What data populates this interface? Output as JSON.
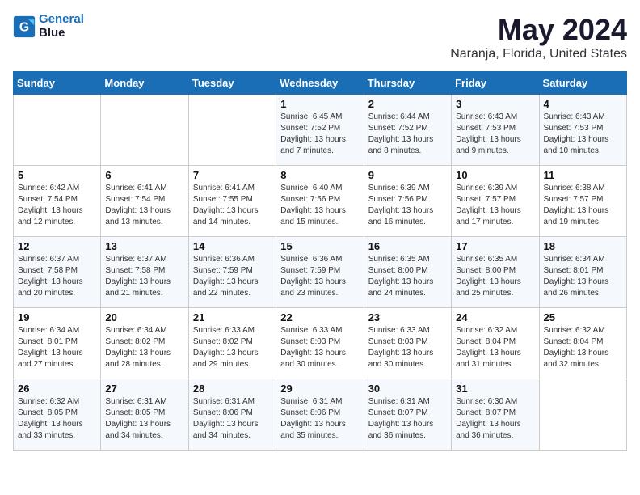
{
  "header": {
    "logo_line1": "General",
    "logo_line2": "Blue",
    "title": "May 2024",
    "subtitle": "Naranja, Florida, United States"
  },
  "weekdays": [
    "Sunday",
    "Monday",
    "Tuesday",
    "Wednesday",
    "Thursday",
    "Friday",
    "Saturday"
  ],
  "weeks": [
    [
      {
        "day": "",
        "info": ""
      },
      {
        "day": "",
        "info": ""
      },
      {
        "day": "",
        "info": ""
      },
      {
        "day": "1",
        "info": "Sunrise: 6:45 AM\nSunset: 7:52 PM\nDaylight: 13 hours\nand 7 minutes."
      },
      {
        "day": "2",
        "info": "Sunrise: 6:44 AM\nSunset: 7:52 PM\nDaylight: 13 hours\nand 8 minutes."
      },
      {
        "day": "3",
        "info": "Sunrise: 6:43 AM\nSunset: 7:53 PM\nDaylight: 13 hours\nand 9 minutes."
      },
      {
        "day": "4",
        "info": "Sunrise: 6:43 AM\nSunset: 7:53 PM\nDaylight: 13 hours\nand 10 minutes."
      }
    ],
    [
      {
        "day": "5",
        "info": "Sunrise: 6:42 AM\nSunset: 7:54 PM\nDaylight: 13 hours\nand 12 minutes."
      },
      {
        "day": "6",
        "info": "Sunrise: 6:41 AM\nSunset: 7:54 PM\nDaylight: 13 hours\nand 13 minutes."
      },
      {
        "day": "7",
        "info": "Sunrise: 6:41 AM\nSunset: 7:55 PM\nDaylight: 13 hours\nand 14 minutes."
      },
      {
        "day": "8",
        "info": "Sunrise: 6:40 AM\nSunset: 7:56 PM\nDaylight: 13 hours\nand 15 minutes."
      },
      {
        "day": "9",
        "info": "Sunrise: 6:39 AM\nSunset: 7:56 PM\nDaylight: 13 hours\nand 16 minutes."
      },
      {
        "day": "10",
        "info": "Sunrise: 6:39 AM\nSunset: 7:57 PM\nDaylight: 13 hours\nand 17 minutes."
      },
      {
        "day": "11",
        "info": "Sunrise: 6:38 AM\nSunset: 7:57 PM\nDaylight: 13 hours\nand 19 minutes."
      }
    ],
    [
      {
        "day": "12",
        "info": "Sunrise: 6:37 AM\nSunset: 7:58 PM\nDaylight: 13 hours\nand 20 minutes."
      },
      {
        "day": "13",
        "info": "Sunrise: 6:37 AM\nSunset: 7:58 PM\nDaylight: 13 hours\nand 21 minutes."
      },
      {
        "day": "14",
        "info": "Sunrise: 6:36 AM\nSunset: 7:59 PM\nDaylight: 13 hours\nand 22 minutes."
      },
      {
        "day": "15",
        "info": "Sunrise: 6:36 AM\nSunset: 7:59 PM\nDaylight: 13 hours\nand 23 minutes."
      },
      {
        "day": "16",
        "info": "Sunrise: 6:35 AM\nSunset: 8:00 PM\nDaylight: 13 hours\nand 24 minutes."
      },
      {
        "day": "17",
        "info": "Sunrise: 6:35 AM\nSunset: 8:00 PM\nDaylight: 13 hours\nand 25 minutes."
      },
      {
        "day": "18",
        "info": "Sunrise: 6:34 AM\nSunset: 8:01 PM\nDaylight: 13 hours\nand 26 minutes."
      }
    ],
    [
      {
        "day": "19",
        "info": "Sunrise: 6:34 AM\nSunset: 8:01 PM\nDaylight: 13 hours\nand 27 minutes."
      },
      {
        "day": "20",
        "info": "Sunrise: 6:34 AM\nSunset: 8:02 PM\nDaylight: 13 hours\nand 28 minutes."
      },
      {
        "day": "21",
        "info": "Sunrise: 6:33 AM\nSunset: 8:02 PM\nDaylight: 13 hours\nand 29 minutes."
      },
      {
        "day": "22",
        "info": "Sunrise: 6:33 AM\nSunset: 8:03 PM\nDaylight: 13 hours\nand 30 minutes."
      },
      {
        "day": "23",
        "info": "Sunrise: 6:33 AM\nSunset: 8:03 PM\nDaylight: 13 hours\nand 30 minutes."
      },
      {
        "day": "24",
        "info": "Sunrise: 6:32 AM\nSunset: 8:04 PM\nDaylight: 13 hours\nand 31 minutes."
      },
      {
        "day": "25",
        "info": "Sunrise: 6:32 AM\nSunset: 8:04 PM\nDaylight: 13 hours\nand 32 minutes."
      }
    ],
    [
      {
        "day": "26",
        "info": "Sunrise: 6:32 AM\nSunset: 8:05 PM\nDaylight: 13 hours\nand 33 minutes."
      },
      {
        "day": "27",
        "info": "Sunrise: 6:31 AM\nSunset: 8:05 PM\nDaylight: 13 hours\nand 34 minutes."
      },
      {
        "day": "28",
        "info": "Sunrise: 6:31 AM\nSunset: 8:06 PM\nDaylight: 13 hours\nand 34 minutes."
      },
      {
        "day": "29",
        "info": "Sunrise: 6:31 AM\nSunset: 8:06 PM\nDaylight: 13 hours\nand 35 minutes."
      },
      {
        "day": "30",
        "info": "Sunrise: 6:31 AM\nSunset: 8:07 PM\nDaylight: 13 hours\nand 36 minutes."
      },
      {
        "day": "31",
        "info": "Sunrise: 6:30 AM\nSunset: 8:07 PM\nDaylight: 13 hours\nand 36 minutes."
      },
      {
        "day": "",
        "info": ""
      }
    ]
  ]
}
